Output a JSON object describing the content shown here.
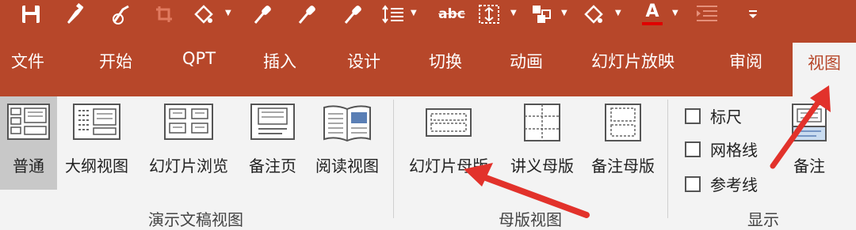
{
  "quick_access": {
    "icons": [
      "save-icon",
      "format-painter-icon",
      "clear-format-icon",
      "crop-icon",
      "shape-fill-icon",
      "eyedropper-icon",
      "eyedropper-icon",
      "eyedropper-icon",
      "line-spacing-icon",
      "strikethrough-icon",
      "text-box-icon",
      "arrange-icon",
      "shape-outline-icon",
      "font-color-icon",
      "highlight-icon",
      "customize-qat-icon"
    ],
    "abc_label": "abc",
    "font_color_letter": "A",
    "accent": "#b7472a"
  },
  "tabs": [
    "文件",
    "开始",
    "QPT",
    "插入",
    "设计",
    "切换",
    "动画",
    "幻灯片放映",
    "审阅",
    "视图"
  ],
  "active_tab": "视图",
  "ribbon": {
    "presentation_views": {
      "group_label": "演示文稿视图",
      "buttons": [
        "普通",
        "大纲视图",
        "幻灯片浏览",
        "备注页",
        "阅读视图"
      ],
      "selected": "普通"
    },
    "master_views": {
      "group_label": "母版视图",
      "buttons": [
        "幻灯片母版",
        "讲义母版",
        "备注母版"
      ]
    },
    "show": {
      "group_label": "显示",
      "checkboxes": [
        {
          "label": "标尺",
          "checked": false
        },
        {
          "label": "网格线",
          "checked": false
        },
        {
          "label": "参考线",
          "checked": false
        }
      ],
      "notes_button": "备注"
    }
  },
  "annotation_color": "#e2322b"
}
